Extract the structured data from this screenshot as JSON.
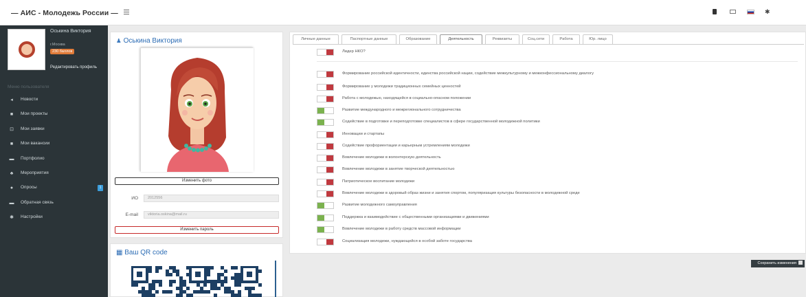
{
  "app": {
    "brand": "— АИС - Молодежь России —"
  },
  "sidebar": {
    "name": "Оськина Виктория",
    "city": "г.Москва",
    "points_badge": "230 баллов",
    "edit_profile": "Редактировать профиль",
    "nav_header": "Меню пользователя",
    "items": [
      {
        "label": "Новости",
        "icon": "megaphone-icon",
        "glyph": "◂"
      },
      {
        "label": "Мои проекты",
        "icon": "book-icon",
        "glyph": "■"
      },
      {
        "label": "Мои заявки",
        "icon": "inbox-icon",
        "glyph": "⊡"
      },
      {
        "label": "Мои вакансии",
        "icon": "briefcase-icon",
        "glyph": "■"
      },
      {
        "label": "Портфолио",
        "icon": "folder-icon",
        "glyph": "▬"
      },
      {
        "label": "Мероприятия",
        "icon": "users-icon",
        "glyph": "♣"
      },
      {
        "label": "Опросы",
        "icon": "clipboard-icon",
        "glyph": "●",
        "count": "1"
      },
      {
        "label": "Обратная связь",
        "icon": "envelope-icon",
        "glyph": "▬"
      },
      {
        "label": "Настройки",
        "icon": "gear-icon",
        "glyph": "✱"
      }
    ]
  },
  "profile_card": {
    "title": "Оськина Виктория",
    "change_photo": "Изменить фото",
    "id_label": "ИО",
    "id_value": "2012556",
    "email_label": "E-mail",
    "email_value": "viktoria.oskina@mail.ru",
    "change_password": "Изменить пароль"
  },
  "qr_card": {
    "title": "Ваш QR code"
  },
  "tabs": [
    {
      "label": "Личные данные",
      "active": false
    },
    {
      "label": "Паспортные данные",
      "active": false
    },
    {
      "label": "Образование",
      "active": false
    },
    {
      "label": "Деятельность",
      "active": true
    },
    {
      "label": "Реквизиты",
      "active": false
    },
    {
      "label": "Соц.сети",
      "active": false
    },
    {
      "label": "Работа",
      "active": false
    },
    {
      "label": "Юр. лицо",
      "active": false
    }
  ],
  "activities": [
    {
      "label": "Лидер НКО?",
      "state": "off"
    },
    {
      "label": "Формирование российской идентичности, единства российской нации, содействие межкультурному и межконфессиональному диалогу",
      "state": "off"
    },
    {
      "label": "Формирование у молодежи традиционных семейных ценностей",
      "state": "off"
    },
    {
      "label": "Работа с молодежью, находящейся в социально-опасном положении",
      "state": "off"
    },
    {
      "label": "Развитие международного и межрегионального сотрудничества",
      "state": "on"
    },
    {
      "label": "Содействие в подготовке и переподготовке специалистов в сфере государственной молодежной политики",
      "state": "on"
    },
    {
      "label": "Инновации и стартапы",
      "state": "off"
    },
    {
      "label": "Содействие профориентации и карьерным устремлениям молодежи",
      "state": "off"
    },
    {
      "label": "Вовлечение молодежи в волонтерскую деятельность",
      "state": "off"
    },
    {
      "label": "Вовлечение молодежи в занятие творческой деятельностью",
      "state": "off"
    },
    {
      "label": "Патриотическое воспитание молодежи",
      "state": "off"
    },
    {
      "label": "Вовлечение молодежи в здоровый образ жизни и занятия спортом, популяризация культуры безопасности в молодежной среде",
      "state": "off"
    },
    {
      "label": "Развитие молодежного самоуправления",
      "state": "on"
    },
    {
      "label": "Поддержка и взаимодействие с общественными организациями и движениями",
      "state": "on"
    },
    {
      "label": "Вовлечение молодежи в работу средств массовой информации",
      "state": "on"
    },
    {
      "label": "Социализация молодежи, нуждающейся в особой заботе государства",
      "state": "off"
    }
  ],
  "save_button": "Сохранить изменения",
  "colors": {
    "toggle_off": "#c0393f",
    "toggle_on": "#7bb24e",
    "sidebar_bg": "#2b3438",
    "link_blue": "#2d6db5"
  }
}
